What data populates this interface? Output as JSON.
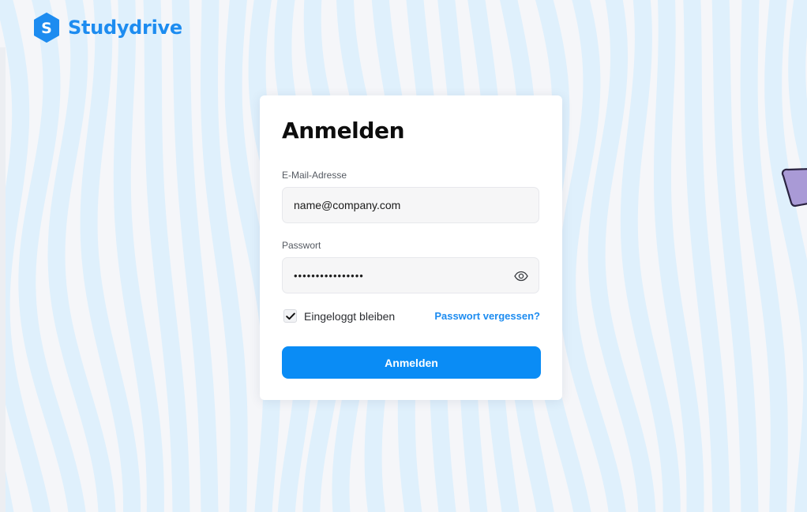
{
  "brand": {
    "name": "Studydrive",
    "mark_letter": "S",
    "color": "#1d8cf0"
  },
  "login": {
    "title": "Anmelden",
    "email_label": "E-Mail-Adresse",
    "email_value": "name@company.com",
    "password_label": "Passwort",
    "password_value": "••••••••••••••••",
    "password_toggle_icon": "eye-icon",
    "remember_label": "Eingeloggt bleiben",
    "remember_checked": true,
    "forgot_label": "Passwort vergessen?",
    "submit_label": "Anmelden",
    "button_color": "#0a8cf5"
  },
  "decoration": {
    "wave_color": "#dff0fc",
    "triangle_color": "#a99ad6"
  }
}
